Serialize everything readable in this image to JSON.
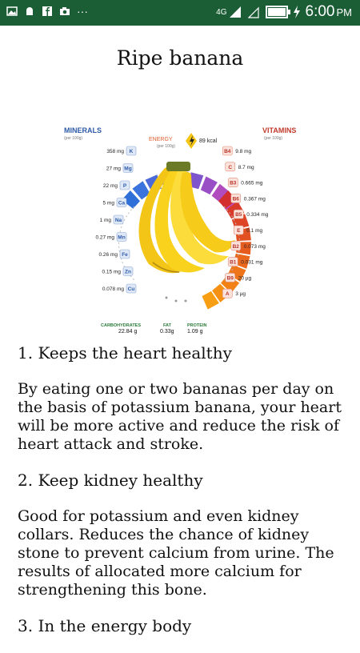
{
  "statusbar": {
    "network_label": "4G",
    "time": "6:00",
    "ampm": "PM"
  },
  "title": "Ripe banana",
  "infographic": {
    "minerals_title": "MINERALS",
    "minerals_per": "(per 100g)",
    "vitamins_title": "VITAMINS",
    "vitamins_per": "(per 100g)",
    "energy_label": "ENERGY",
    "energy_per": "(per 100g)",
    "energy_value": "89 kcal",
    "minerals": [
      {
        "value": "358 mg",
        "symbol": "K"
      },
      {
        "value": "27 mg",
        "symbol": "Mg"
      },
      {
        "value": "22 mg",
        "symbol": "P"
      },
      {
        "value": "5 mg",
        "symbol": "Ca"
      },
      {
        "value": "1 mg",
        "symbol": "Na"
      },
      {
        "value": "0.27 mg",
        "symbol": "Mn"
      },
      {
        "value": "0.26 mg",
        "symbol": "Fe"
      },
      {
        "value": "0.15 mg",
        "symbol": "Zn"
      },
      {
        "value": "0.078 mg",
        "symbol": "Cu"
      }
    ],
    "vitamins": [
      {
        "symbol": "B4",
        "value": "9.8 mg"
      },
      {
        "symbol": "C",
        "value": "8.7 mg"
      },
      {
        "symbol": "B3",
        "value": "0.665 mg"
      },
      {
        "symbol": "B6",
        "value": "0.367 mg"
      },
      {
        "symbol": "B5",
        "value": "0.334 mg"
      },
      {
        "symbol": "E",
        "value": "0.1 mg"
      },
      {
        "symbol": "B2",
        "value": "0.073 mg"
      },
      {
        "symbol": "B1",
        "value": "0.031 mg"
      },
      {
        "symbol": "B9",
        "value": "20 µg"
      },
      {
        "symbol": "A",
        "value": "3 µg"
      }
    ],
    "macros": [
      {
        "label": "CARBOHYDRATES",
        "value": "22.84 g"
      },
      {
        "label": "FAT",
        "value": "0.33g"
      },
      {
        "label": "PROTEIN",
        "value": "1.09 g"
      }
    ]
  },
  "content": {
    "heading1": "1. Keeps the heart healthy",
    "para1": "By eating one or two bananas per day on the basis of potassium banana, your heart will be more active and reduce the risk of heart attack and stroke.",
    "heading2": "2. Keep kidney healthy",
    "para2": "Good for potassium and even kidney collars. Reduces the chance of kidney stone to prevent calcium from urine. The results of allocated more calcium for strengthening this bone.",
    "heading3": "3. In the energy body"
  }
}
